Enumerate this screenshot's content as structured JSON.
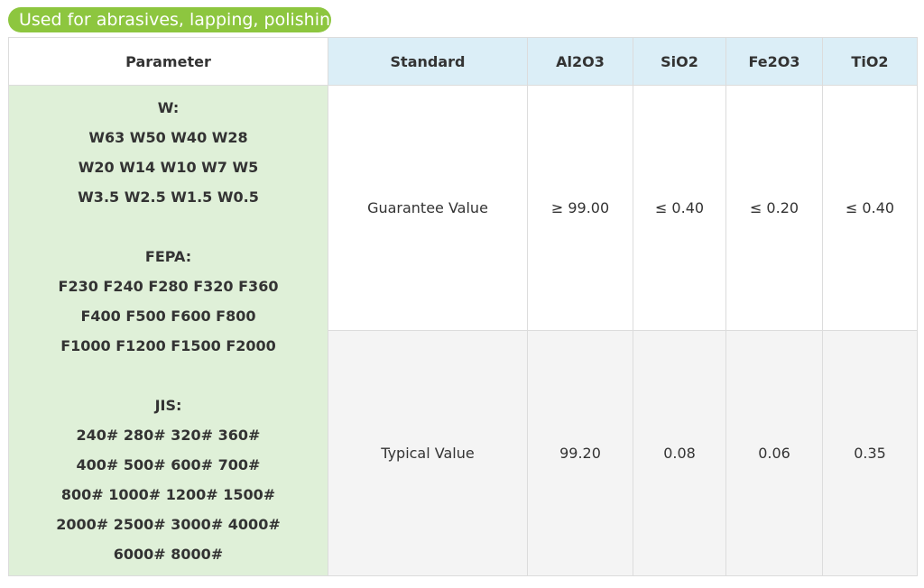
{
  "badge": "Used for abrasives, lapping, polishing",
  "headers": {
    "parameter": "Parameter",
    "standard": "Standard",
    "al2o3": "Al2O3",
    "sio2": "SiO2",
    "fe2o3": "Fe2O3",
    "tio2": "TiO2"
  },
  "parameter": {
    "w_label": "W:",
    "w_lines": [
      "W63 W50 W40 W28",
      "W20 W14 W10 W7 W5",
      "W3.5 W2.5 W1.5 W0.5"
    ],
    "fepa_label": "FEPA:",
    "fepa_lines": [
      "F230 F240 F280 F320 F360",
      "F400 F500 F600 F800",
      "F1000 F1200 F1500 F2000"
    ],
    "jis_label": "JIS:",
    "jis_lines": [
      "240# 280# 320# 360#",
      "400# 500# 600# 700#",
      "800# 1000# 1200# 1500#",
      "2000# 2500# 3000# 4000#",
      "6000# 8000#"
    ]
  },
  "rows": [
    {
      "standard": "Guarantee Value",
      "al2o3": "≥ 99.00",
      "sio2": "≤ 0.40",
      "fe2o3": "≤ 0.20",
      "tio2": "≤ 0.40"
    },
    {
      "standard": "Typical Value",
      "al2o3": "99.20",
      "sio2": "0.08",
      "fe2o3": "0.06",
      "tio2": "0.35"
    }
  ]
}
